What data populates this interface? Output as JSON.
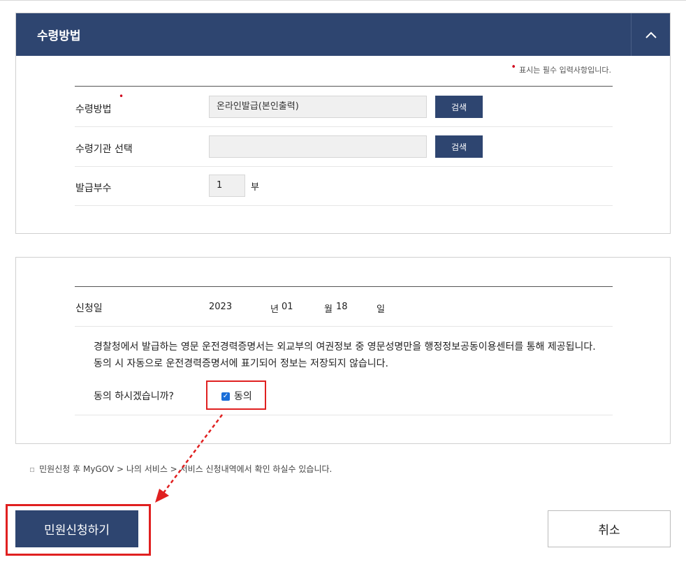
{
  "section": {
    "title": "수령방법"
  },
  "required_note": "표시는 필수 입력사항입니다.",
  "form": {
    "method_label": "수령방법",
    "method_value": "온라인발급(본인출력)",
    "agency_label": "수령기관 선택",
    "agency_value": "",
    "search_label": "검색",
    "copies_label": "발급부수",
    "copies_value": "1",
    "copies_unit": "부"
  },
  "application": {
    "date_label": "신청일",
    "year": "2023",
    "year_unit": "년",
    "month": "01",
    "month_unit": "월",
    "day": "18",
    "day_unit": "일",
    "consent_text": "경찰청에서 발급하는 영문 운전경력증명서는 외교부의 여권정보 중 영문성명만을 행정정보공동이용센터를 통해 제공됩니다. 동의 시 자동으로 운전경력증명서에 표기되어 정보는 저장되지 않습니다.",
    "consent_question": "동의 하시겠습니까?",
    "agree_label": "동의",
    "agree_checked": true
  },
  "info_note": "민원신청 후 MyGOV > 나의 서비스 > 서비스 신청내역에서 확인 하실수 있습니다.",
  "buttons": {
    "submit": "민원신청하기",
    "cancel": "취소"
  },
  "colors": {
    "primary": "#2e4570",
    "highlight": "#e02020",
    "required": "#d0021b",
    "checkbox": "#1a6ed8"
  }
}
